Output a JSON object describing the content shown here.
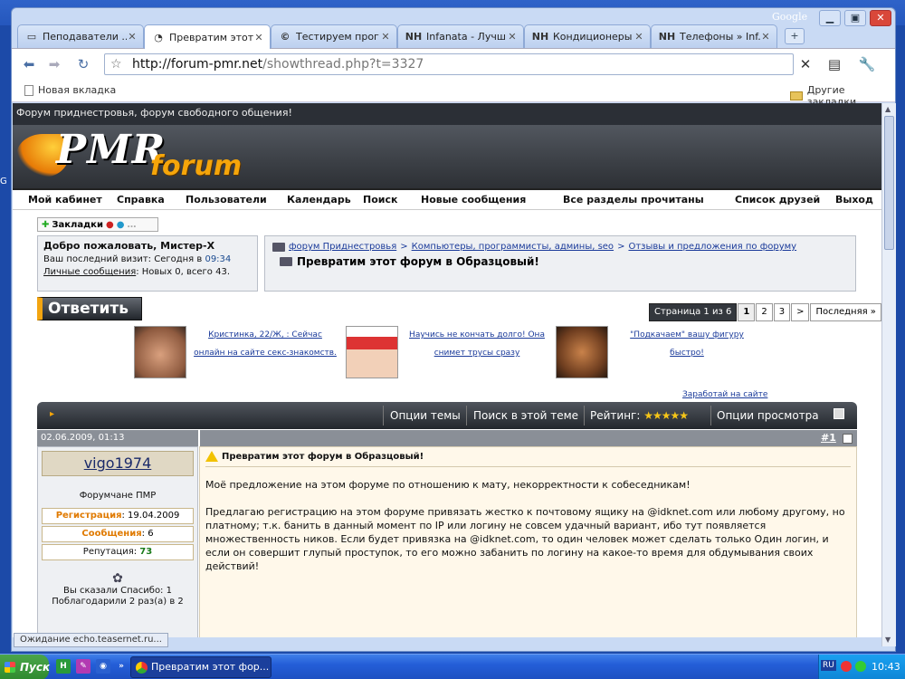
{
  "browser": {
    "tabs": [
      {
        "title": "Пеподаватели ...",
        "icon": "page-icon",
        "active": false
      },
      {
        "title": "Превратим этот ...",
        "icon": "loading-icon",
        "active": true
      },
      {
        "title": "Тестируем прог...",
        "icon": "c-icon",
        "active": false
      },
      {
        "title": "Infanata - Лучш...",
        "icon": "nh-icon",
        "active": false
      },
      {
        "title": "Кондиционеры ...",
        "icon": "nh-icon",
        "active": false
      },
      {
        "title": "Телефоны » Inf...",
        "icon": "nh-icon",
        "active": false
      }
    ],
    "fav_c": "©",
    "fav_nh": "NH",
    "google_label": "Google",
    "url_host": "http://forum-pmr.net",
    "url_path": "/showthread.php?t=3327",
    "bookmark_new_tab": "Новая вкладка",
    "bookmark_other": "Другие закладки",
    "status_text": "Ожидание echo.teasernet.ru..."
  },
  "site": {
    "top_title": "Форум приднестровья, форум свободного общения!",
    "logo_main": "PMR",
    "logo_sub": "forum",
    "nav": [
      "Мой кабинет",
      "Справка",
      "Пользователи",
      "Календарь",
      "Поиск",
      "Новые сообщения",
      "Все разделы прочитаны",
      "Список друзей",
      "Выход"
    ],
    "bookmarks_label": "Закладки",
    "welcome": {
      "greeting": "Добро пожаловать, Мистер-Х",
      "last_visit_label": "Ваш последний визит: Сегодня в ",
      "last_visit_time": "09:34",
      "messages_link": "Личные сообщения",
      "messages_info": ": Новых 0, всего 43."
    },
    "breadcrumb": {
      "items": [
        "форум Приднестровья",
        "Компьютеры, программисты, админы, seo",
        "Отзывы и предложения по форуму"
      ],
      "separator": ">",
      "current": "Превратим этот форум в Образцовый!"
    },
    "reply_button": "Ответить",
    "pager": {
      "label": "Страница 1 из 6",
      "pages": [
        "1",
        "2",
        "3"
      ],
      "next": ">",
      "last": "Последняя »"
    },
    "ads": [
      {
        "text": "Кристинка, 22/Ж, : Сейчас онлайн на сайте секс-знакомств."
      },
      {
        "text": "Научись не кончать долго! Она снимет трусы сразу"
      },
      {
        "text": "\"Подкачаем\" вашу фигуру быстро!"
      }
    ],
    "earn_link": "Заработай на сайте",
    "thread_tools": {
      "options": "Опции темы",
      "search": "Поиск в этой теме",
      "rating_label": "Рейтинг:",
      "rating_stars": "★★★★★",
      "view": "Опции просмотра"
    },
    "post": {
      "date": "02.06.2009, 01:13",
      "number": "#1",
      "username": "vigo1974",
      "user_title": "Форумчане ПМР",
      "reg_label": "Регистрация",
      "reg_value": ": 19.04.2009",
      "posts_label": "Сообщения",
      "posts_value": ": 6",
      "rep_label": "Репутация",
      "rep_sep": ": ",
      "rep_value": "73",
      "thanks_said": "Вы сказали Спасибо: 1",
      "thanks_got": "Поблагодарили 2 раз(а) в 2",
      "title": "Превратим этот форум в Образцовый!",
      "body": [
        "Моё предложение на этом форуме по отношению к мату, некорректности к собеседникам!",
        "Предлагаю регистрацию на этом форуме привязать жестко к почтовому ящику на @idknet.com или любому другому, но платному; т.к. банить в данный момент по IP или логину не совсем удачный вариант, ибо тут появляется множественность ников. Если будет привязка на @idknet.com, то один человек может сделать только Один логин, и если он совершит глупый проступок, то его можно забанить по логину на какое-то время для обдумывания своих действий!"
      ]
    }
  },
  "taskbar": {
    "start": "Пуск",
    "window_title": "Превратим этот фор...",
    "language": "RU",
    "clock": "10:43",
    "quicklaunch_overflow": "»"
  },
  "desktop": {
    "edge_label": "G"
  }
}
